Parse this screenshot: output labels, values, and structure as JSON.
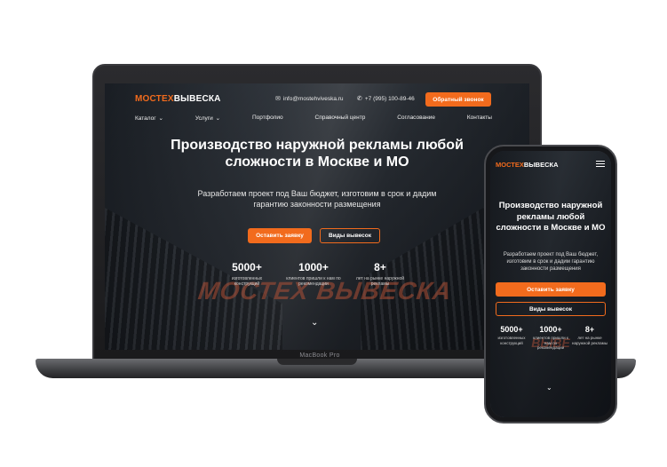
{
  "brand": {
    "part1": "МОСТЕХ",
    "part2": "ВЫВЕСКА",
    "accent": "#f26b1d"
  },
  "laptop": {
    "model": "MacBook Pro"
  },
  "header": {
    "email": "info@mostehviveska.ru",
    "phone": "+7 (995) 100-89-46",
    "callback_label": "Обратный звонок",
    "email_icon": "envelope-icon",
    "phone_icon": "phone-icon"
  },
  "nav": {
    "items": [
      {
        "label": "Каталог",
        "has_dropdown": true
      },
      {
        "label": "Услуги",
        "has_dropdown": true
      },
      {
        "label": "Портфолио",
        "has_dropdown": false
      },
      {
        "label": "Справочный центр",
        "has_dropdown": false
      },
      {
        "label": "Согласование",
        "has_dropdown": false
      },
      {
        "label": "Контакты",
        "has_dropdown": false
      }
    ]
  },
  "hero": {
    "title": "Производство наружной рекламы любой сложности в Москве и МО",
    "subtitle": "Разработаем проект под Ваш бюджет, изготовим в срок и дадим гарантию законности размещения",
    "primary_button": "Оставить заявку",
    "secondary_button": "Виды вывесок",
    "stats": [
      {
        "number": "5000+",
        "label": "изготовленных конструкций"
      },
      {
        "number": "1000+",
        "label": "клиентов пришли к нам по рекомендации"
      },
      {
        "number": "8+",
        "label": "лет на рынке наружной рекламы"
      }
    ],
    "sign_text": "МОСТЕХ ВЫВЕСКА",
    "phone_sign_text": "ВЫВЕ"
  }
}
